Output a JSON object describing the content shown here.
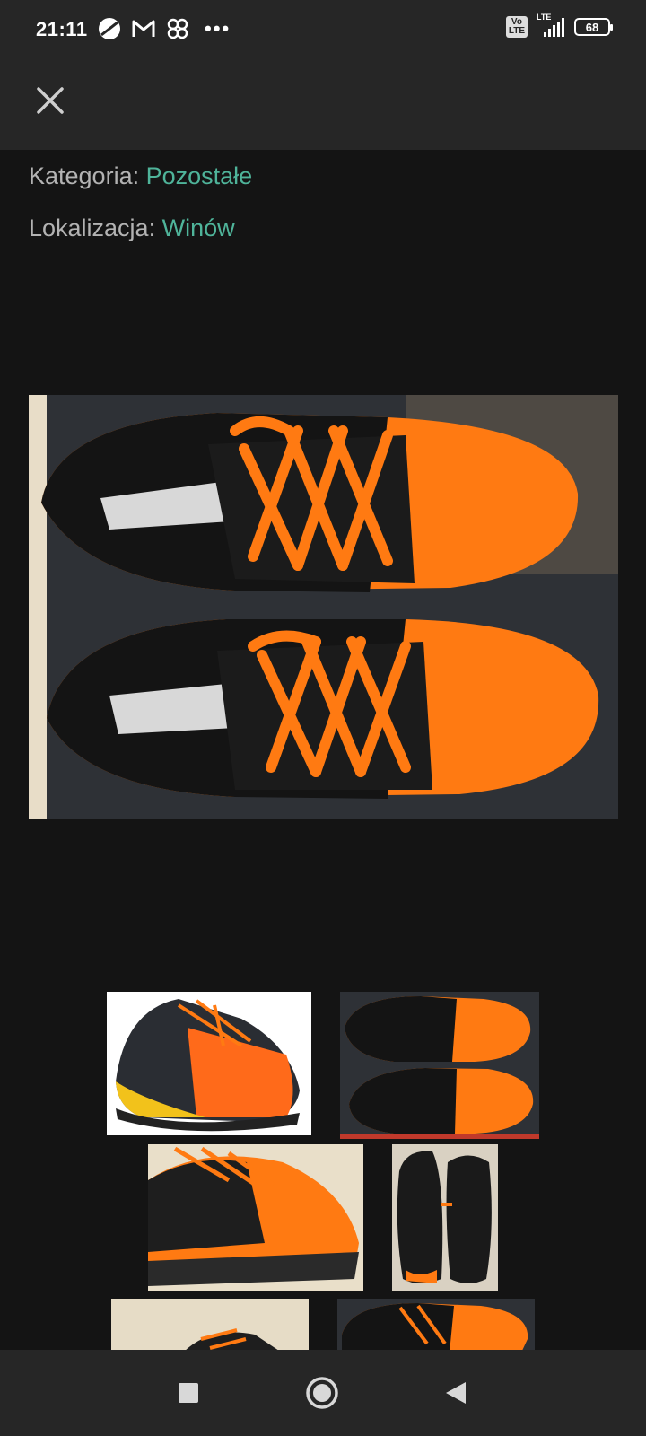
{
  "status_bar": {
    "time": "21:11",
    "icons": [
      "circle-slash-icon",
      "gmail-icon",
      "pinwheel-icon"
    ],
    "more": "•••",
    "volte": "Vo\nLTE",
    "network": "LTE",
    "battery": "68"
  },
  "header": {
    "close_icon": "close-icon"
  },
  "details": {
    "category_label": "Kategoria:",
    "category_value": "Pozostałe",
    "location_label": "Lokalizacja:",
    "location_value": "Winów"
  },
  "colors": {
    "accent": "#4fb49a",
    "background": "#141414",
    "bar": "#262626",
    "shoe_orange": "#ff7a12"
  },
  "nav_bar": {
    "buttons": [
      "recents-square-icon",
      "home-circle-icon",
      "back-triangle-icon"
    ]
  }
}
